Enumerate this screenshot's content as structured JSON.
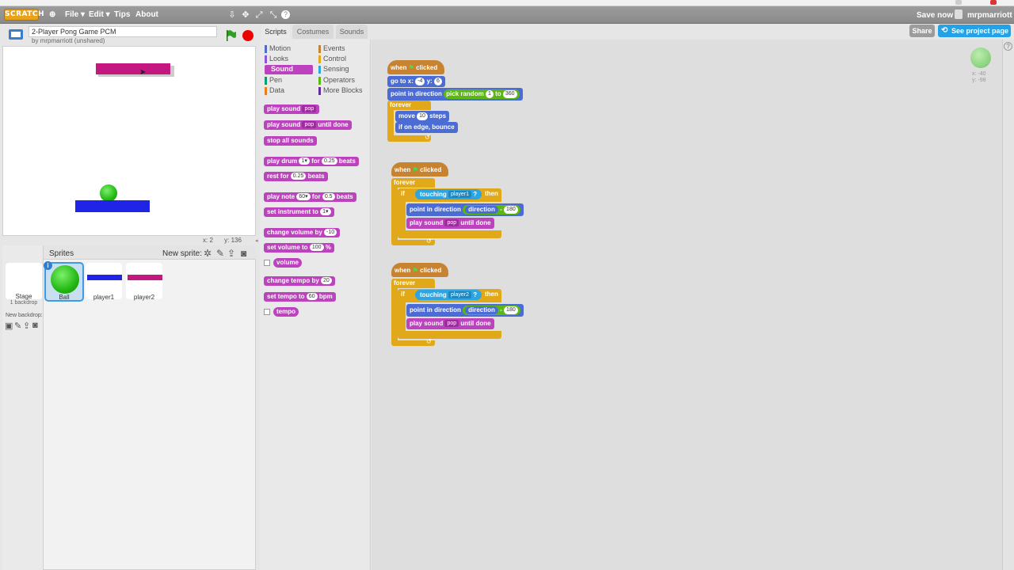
{
  "menubar": {
    "logo": "SCRATCH",
    "items": [
      "File ▾",
      "Edit ▾",
      "Tips",
      "About"
    ],
    "save_now": "Save now",
    "username": "mrpmarriott ▾"
  },
  "project": {
    "title": "2-Player Pong Game PCM",
    "by": "by mrpmarriott (unshared)"
  },
  "header_buttons": {
    "share": "Share",
    "see_project": "See project page"
  },
  "stage": {
    "coords_x": "x: 2",
    "coords_y": "y: 136"
  },
  "sprites_panel": {
    "title": "Sprites",
    "new_sprite": "New sprite:",
    "stage_label": "Stage",
    "stage_sub": "1 backdrop",
    "new_backdrop": "New backdrop:",
    "sprites": [
      "Ball",
      "player1",
      "player2"
    ]
  },
  "tabs": [
    "Scripts",
    "Costumes",
    "Sounds"
  ],
  "categories": {
    "left": [
      "Motion",
      "Looks",
      "Sound",
      "Pen",
      "Data"
    ],
    "right": [
      "Events",
      "Control",
      "Sensing",
      "Operators",
      "More Blocks"
    ],
    "selected": "Sound"
  },
  "palette_blocks": {
    "play_sound": "play sound",
    "play_sound_until": "play sound",
    "until_done": "until done",
    "pop": "pop",
    "stop_all": "stop all sounds",
    "play_drum": "play drum",
    "for": "for",
    "beats": "beats",
    "drum_val": "1▾",
    "drum_beats": "0.25",
    "rest_for": "rest for",
    "rest_val": "0.25",
    "play_note": "play note",
    "note_val": "60▾",
    "note_beats": "0.5",
    "set_instrument": "set instrument to",
    "instrument_val": "1▾",
    "change_volume": "change volume by",
    "change_volume_val": "-10",
    "set_volume": "set volume to",
    "set_volume_val": "100",
    "percent": "%",
    "volume": "volume",
    "change_tempo": "change tempo by",
    "change_tempo_val": "20",
    "set_tempo": "set tempo to",
    "set_tempo_val": "60",
    "bpm": "bpm",
    "tempo": "tempo"
  },
  "script1": {
    "when": "when",
    "clicked": "clicked",
    "goto": "go to x:",
    "goto_x": "-4",
    "y_label": "y:",
    "goto_y": "6",
    "point_dir": "point in direction",
    "pick_random": "pick random",
    "rand_from": "1",
    "to": "to",
    "rand_to": "360",
    "forever": "forever",
    "move": "move",
    "move_val": "10",
    "steps": "steps",
    "bounce": "if on edge, bounce"
  },
  "script2": {
    "when": "when",
    "clicked": "clicked",
    "forever": "forever",
    "if": "if",
    "touching": "touching",
    "target": "player1",
    "q": "?",
    "then": "then",
    "point_dir": "point in direction",
    "direction": "direction",
    "val": "180",
    "play_sound": "play sound",
    "pop": "pop",
    "until_done": "until done"
  },
  "script3": {
    "when": "when",
    "clicked": "clicked",
    "forever": "forever",
    "if": "if",
    "touching": "touching",
    "target": "player2",
    "q": "?",
    "then": "then",
    "point_dir": "point in direction",
    "direction": "direction",
    "val": "180",
    "play_sound": "play sound",
    "pop": "pop",
    "until_done": "until done"
  },
  "sprite_info": {
    "x": "x: -40",
    "y": "y: -98"
  },
  "colors": {
    "motion": "#4a6cd4",
    "looks": "#8a55d7",
    "sound": "#bd42bd",
    "pen": "#0e9a6c",
    "data": "#ee7d16",
    "events": "#c88330",
    "control": "#e1a91a",
    "sensing": "#2ca5e2",
    "operators": "#5cb712",
    "more_blocks": "#632d99"
  }
}
